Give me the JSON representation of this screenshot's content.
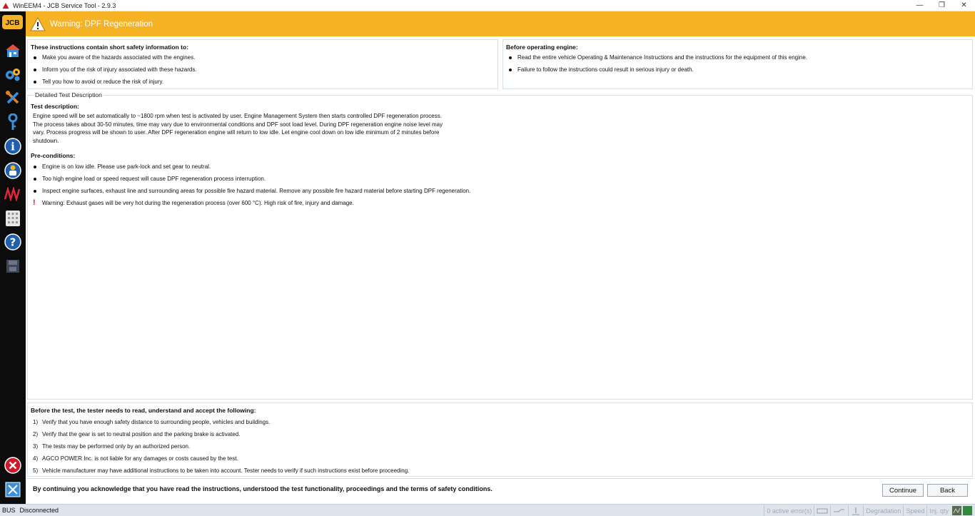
{
  "window": {
    "title": "WinEEM4 - JCB Service Tool - 2.9.3",
    "minimize": "—",
    "maximize": "❐",
    "close": "✕"
  },
  "banner": {
    "title": "Warning: DPF Regeneration",
    "color": "#f5b223"
  },
  "sidebar": {
    "logo_text": "JCB",
    "icons": [
      "home-icon",
      "settings-gears-icon",
      "tools-icon",
      "key-icon",
      "info-icon",
      "help-person-icon",
      "oscilloscope-icon",
      "keypad-icon",
      "question-icon",
      "save-icon",
      "cancel-icon",
      "exit-icon"
    ]
  },
  "safety": {
    "title": "These instructions contain short safety information to:",
    "items": [
      "Make you aware of the hazards associated with the engines.",
      "Inform you of the risk of injury associated with these hazards.",
      "Tell you how to avoid or reduce the risk of injury."
    ]
  },
  "before_operating": {
    "title": "Before operating engine:",
    "items": [
      "Read the entire vehicle Operating & Maintenance Instructions and the instructions for the equipment of this engine.",
      "Failure to follow the instructions could result in serious injury or death."
    ]
  },
  "detailed": {
    "section_label": "Detailed Test Description",
    "test_title": "Test description:",
    "test_text": "Engine speed will be set automatically to ~1800 rpm when test is activated by user. Engine Management System then starts controlled DPF regeneration process. The process takes about 30-50 minutes, time may vary due to environmental conditions and DPF soot load level. During DPF regeneration engine noise level may vary. Process progress will be shown to user. After DPF regeneration engine will return to low idle. Let engine cool down on low idle minimum of 2 minutes before shutdown.",
    "pre_title": "Pre-conditions:",
    "pre_items": [
      "Engine is on low idle. Please use park-lock and set gear to neutral.",
      "Too high engine load or speed request will cause DPF regeneration process interruption.",
      "Inspect engine surfaces, exhaust line and surrounding areas for possible fire hazard material. Remove any possible fire hazard material before starting DPF regeneration."
    ],
    "warning_mark": "!",
    "warning_text": "Warning: Exhaust gases will be very hot during the regeneration process (over 600 °C). High risk of fire, injury and damage."
  },
  "before_test": {
    "title": "Before the test, the tester needs to read, understand and accept the following:",
    "items": [
      {
        "num": "1)",
        "text": "Verify that you have enough safety distance to surrounding people, vehicles and buildings."
      },
      {
        "num": "2)",
        "text": "Verify that the gear is set to neutral position and the parking brake is activated."
      },
      {
        "num": "3)",
        "text": "The tests may be performed only by an authorized person."
      },
      {
        "num": "4)",
        "text": "AGCO POWER Inc. is not liable for any damages or costs caused by the test."
      },
      {
        "num": "5)",
        "text": "Vehicle manufacturer may have additional instructions to be taken into account. Tester needs to verify if such instructions exist before proceeding."
      }
    ]
  },
  "ack": {
    "text": "By continuing you acknowledge that you have read the instructions, understood the test functionality, proceedings and the terms of safety conditions.",
    "continue_label": "Continue",
    "back_label": "Back"
  },
  "status": {
    "bus_label": "BUS",
    "connection": "Disconnected",
    "errors": "0 active error(s)",
    "degradation": "Degradation",
    "speed": "Speed",
    "inj": "Inj. qty"
  }
}
